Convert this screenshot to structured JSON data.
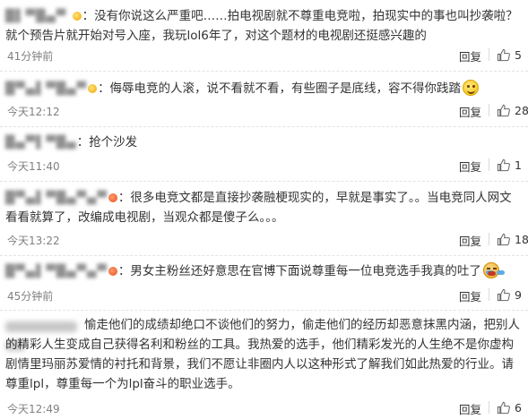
{
  "reply_label": "回复",
  "comments": [
    {
      "name": "█▌▀█▄▀ ",
      "text": "：没有你说这么严重吧……拍电视剧就不尊重电竞啦，拍现实中的事也叫抄袭啦？就个预告片就开始对号入座，我玩lol6年了，对这个题材的电视剧还挺感兴趣的",
      "time": "41分钟前",
      "likes": "5"
    },
    {
      "name": "█▀▄▌▀█▄▀",
      "text": "：侮辱电竞的人滚，说不看就不看，有些圈子是底线，容不得你践踏",
      "emoji": "smile-icon",
      "time": "今天12:12",
      "likes": "28"
    },
    {
      "name": "█▄▀▌▀█▄",
      "text": "：抢个沙发",
      "time": "今天11:40",
      "likes": "1"
    },
    {
      "name": "█▀▄▌▀█▄▀▄▀",
      "text": "：很多电竞文都是直接抄袭融梗现实的，早就是事实了。。当电竞同人网文看看就算了，改编成电视剧，当观众都是傻子么。。。",
      "time": "今天13:22",
      "likes": "18"
    },
    {
      "name": "█▀▄▌▀█▄▀▄▀",
      "text": "：男女主粉丝还好意思在官博下面说尊重每一位电竞选手我真的吐了",
      "emoji": "cry-icon",
      "time": "45分钟前",
      "likes": "9"
    },
    {
      "text": "愉走他们的成绩却绝口不谈他们的努力，偷走他们的经历却恶意抹黑内涵，把别人的精彩人生变成自己获得名利和粉丝的工具。我热爱的选手，他们精彩发光的人生绝不是你虚构剧情里玛丽苏爱情的衬托和背景，我们不愿让非圈内人以这种形式了解我们如此热爱的行业。请尊重lpl，尊重每一个为lpl奋斗的职业选手。",
      "time": "今天12:49",
      "likes": "6"
    }
  ],
  "colors": {
    "text": "#333333",
    "meta": "#808080",
    "divider": "#e3e3e3",
    "badge_gold": "#f0a400",
    "badge_red": "#e8531f"
  }
}
